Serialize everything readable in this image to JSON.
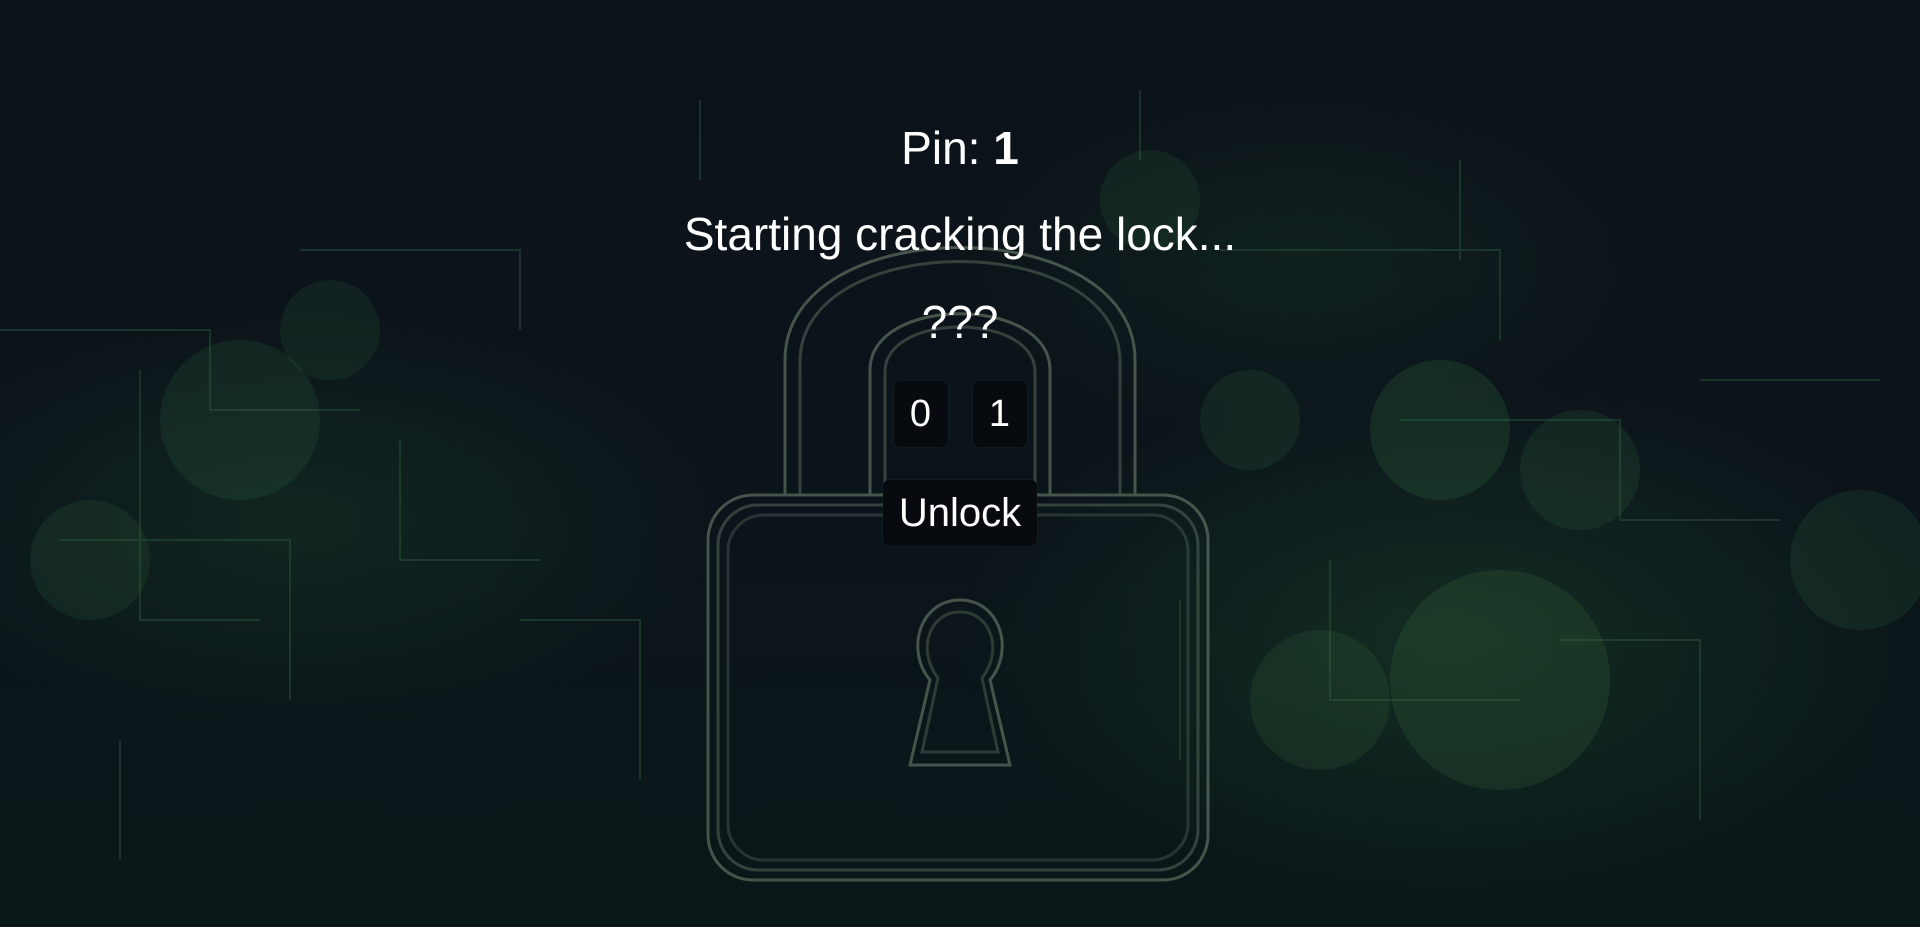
{
  "pin": {
    "label": "Pin:",
    "value": "1"
  },
  "status": {
    "message": "Starting cracking the lock..."
  },
  "hint": {
    "text": "???"
  },
  "digits": [
    {
      "label": "0"
    },
    {
      "label": "1"
    }
  ],
  "actions": {
    "unlock_label": "Unlock"
  },
  "theme": {
    "background": "#0b1016",
    "accent": "#2f7a46",
    "lock_outline": "#5a6b5c",
    "button_bg": "#070b0f",
    "text": "#ffffff"
  },
  "background_image": {
    "icon": "padlock-icon"
  }
}
